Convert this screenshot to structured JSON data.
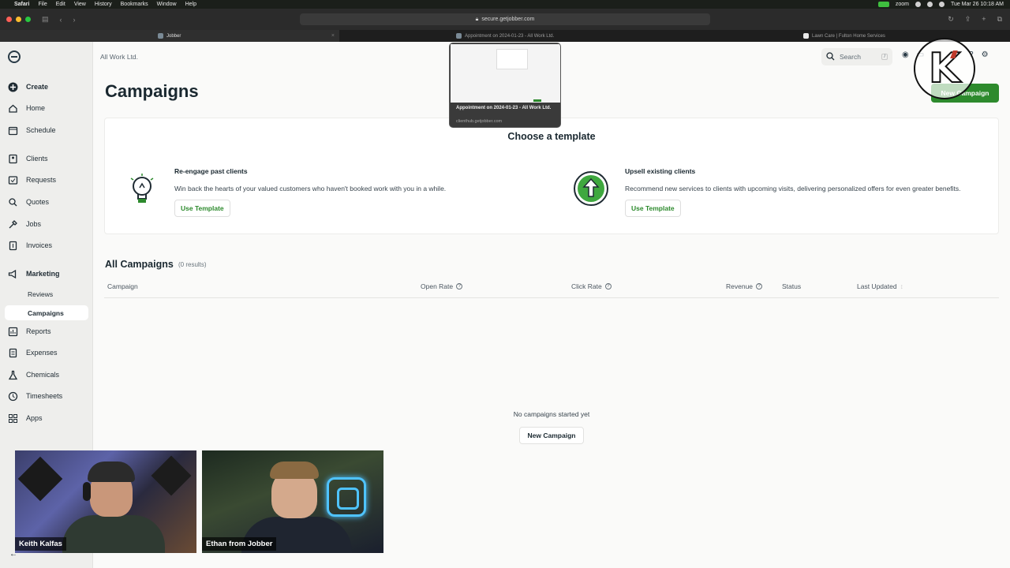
{
  "menubar": {
    "items": [
      "Safari",
      "File",
      "Edit",
      "View",
      "History",
      "Bookmarks",
      "Window",
      "Help"
    ],
    "zoom_label": "zoom",
    "datetime": "Tue Mar 26  10:18 AM"
  },
  "browser": {
    "url": "secure.getjobber.com",
    "tabs": [
      {
        "label": "Jobber",
        "active": true
      },
      {
        "label": "Appointment on 2024-01-23 - All Work Ltd.",
        "active": false
      },
      {
        "label": "Lawn Care | Fulton Home Services",
        "active": false
      }
    ]
  },
  "tab_preview": {
    "title": "Appointment on 2024-01-23 - All Work Ltd.",
    "url": "clienthub.getjobber.com"
  },
  "sidebar": {
    "items": [
      {
        "label": "Create",
        "icon": "plus-circle-icon"
      },
      {
        "label": "Home",
        "icon": "home-icon"
      },
      {
        "label": "Schedule",
        "icon": "calendar-icon"
      },
      {
        "label": "Clients",
        "icon": "clients-icon"
      },
      {
        "label": "Requests",
        "icon": "requests-icon"
      },
      {
        "label": "Quotes",
        "icon": "quotes-icon"
      },
      {
        "label": "Jobs",
        "icon": "jobs-icon"
      },
      {
        "label": "Invoices",
        "icon": "invoices-icon"
      },
      {
        "label": "Marketing",
        "icon": "megaphone-icon"
      },
      {
        "label": "Reports",
        "icon": "reports-icon"
      },
      {
        "label": "Expenses",
        "icon": "expenses-icon"
      },
      {
        "label": "Chemicals",
        "icon": "flask-icon"
      },
      {
        "label": "Timesheets",
        "icon": "clock-icon"
      },
      {
        "label": "Apps",
        "icon": "apps-icon"
      }
    ],
    "marketing_sub": [
      "Reviews",
      "Campaigns"
    ]
  },
  "header": {
    "company": "All Work Ltd.",
    "search_label": "Search",
    "search_shortcut": "/",
    "new_campaign": "New Campaign"
  },
  "page": {
    "title": "Campaigns",
    "choose_template": "Choose a template",
    "templates": [
      {
        "title": "Re-engage past clients",
        "description": "Win back the hearts of your valued customers who haven't booked work with you in a while.",
        "button": "Use Template"
      },
      {
        "title": "Upsell existing clients",
        "description": "Recommend new services to clients with upcoming visits, delivering personalized offers for even greater benefits.",
        "button": "Use Template"
      }
    ],
    "all_campaigns": "All Campaigns",
    "results": "(0 results)",
    "columns": [
      "Campaign",
      "Open Rate",
      "Click Rate",
      "Revenue",
      "Status",
      "Last Updated"
    ],
    "empty_text": "No campaigns started yet",
    "empty_button": "New Campaign"
  },
  "video": {
    "participants": [
      "Keith Kalfas",
      "Ethan from Jobber"
    ]
  },
  "colors": {
    "accent_green": "#2d8a2d",
    "text_dark": "#1a2830"
  }
}
